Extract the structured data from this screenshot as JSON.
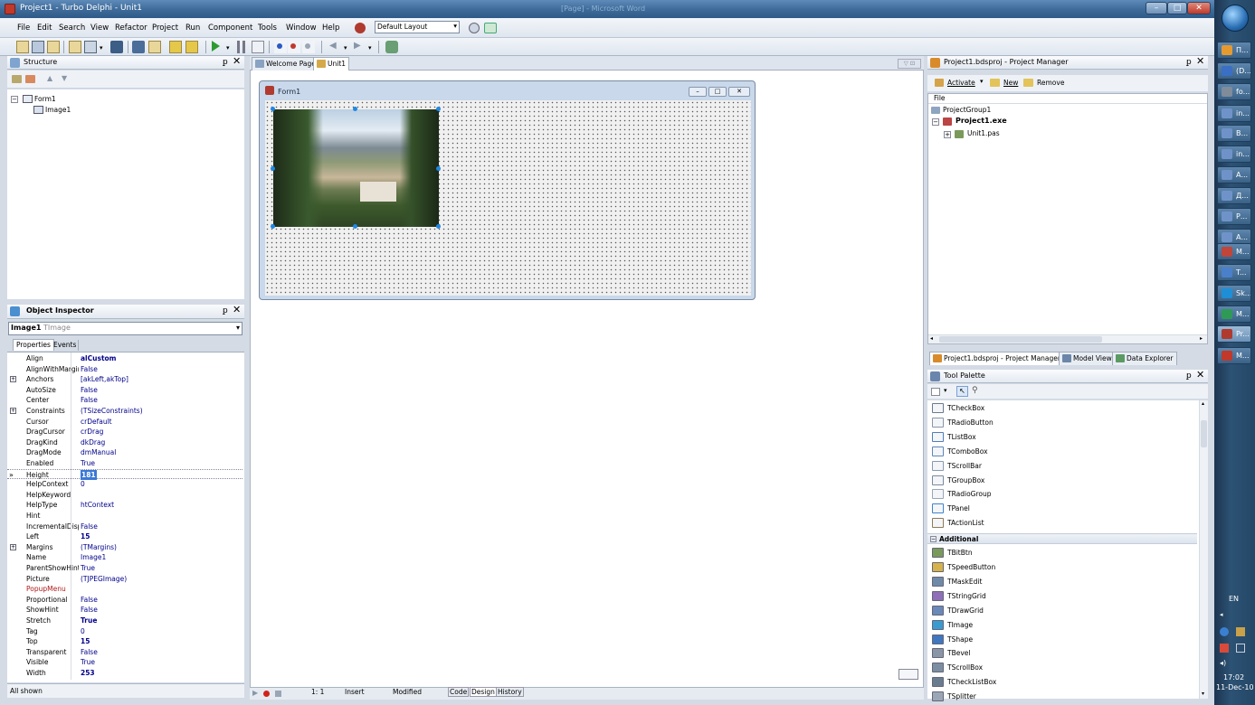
{
  "titlebar": {
    "title": "Project1 - Turbo Delphi - Unit1",
    "background_title": "[Page] - Microsoft Word"
  },
  "menubar": [
    "File",
    "Edit",
    "Search",
    "View",
    "Refactor",
    "Project",
    "Run",
    "Component",
    "Tools",
    "Window",
    "Help"
  ],
  "layout_combo": "Default Layout",
  "structure": {
    "title": "Structure",
    "tree": [
      "Form1",
      "Image1"
    ]
  },
  "inspector": {
    "title": "Object Inspector",
    "object_name": "Image1",
    "object_type": "TImage",
    "tabs": [
      "Properties",
      "Events"
    ],
    "props": [
      {
        "n": "Align",
        "v": "alCustom",
        "b": true
      },
      {
        "n": "AlignWithMargins",
        "v": "False"
      },
      {
        "n": "Anchors",
        "v": "[akLeft,akTop]",
        "e": true
      },
      {
        "n": "AutoSize",
        "v": "False"
      },
      {
        "n": "Center",
        "v": "False"
      },
      {
        "n": "Constraints",
        "v": "(TSizeConstraints)",
        "e": true
      },
      {
        "n": "Cursor",
        "v": "crDefault"
      },
      {
        "n": "DragCursor",
        "v": "crDrag"
      },
      {
        "n": "DragKind",
        "v": "dkDrag"
      },
      {
        "n": "DragMode",
        "v": "dmManual"
      },
      {
        "n": "Enabled",
        "v": "True"
      },
      {
        "n": "Height",
        "v": "181",
        "sel": true
      },
      {
        "n": "HelpContext",
        "v": "0"
      },
      {
        "n": "HelpKeyword",
        "v": ""
      },
      {
        "n": "HelpType",
        "v": "htContext"
      },
      {
        "n": "Hint",
        "v": ""
      },
      {
        "n": "IncrementalDispl",
        "v": "False"
      },
      {
        "n": "Left",
        "v": "15",
        "b": true
      },
      {
        "n": "Margins",
        "v": "(TMargins)",
        "e": true
      },
      {
        "n": "Name",
        "v": "Image1"
      },
      {
        "n": "ParentShowHint",
        "v": "True"
      },
      {
        "n": "Picture",
        "v": "(TJPEGImage)"
      },
      {
        "n": "PopupMenu",
        "v": "",
        "red": true
      },
      {
        "n": "Proportional",
        "v": "False"
      },
      {
        "n": "ShowHint",
        "v": "False"
      },
      {
        "n": "Stretch",
        "v": "True",
        "b": true
      },
      {
        "n": "Tag",
        "v": "0"
      },
      {
        "n": "Top",
        "v": "15",
        "b": true
      },
      {
        "n": "Transparent",
        "v": "False"
      },
      {
        "n": "Visible",
        "v": "True"
      },
      {
        "n": "Width",
        "v": "253",
        "b": true
      }
    ],
    "status": "All shown"
  },
  "editor": {
    "tabs": [
      "Welcome Page",
      "Unit1"
    ],
    "form_caption": "Form1",
    "status": {
      "position": "1:  1",
      "mode": "Insert",
      "modified": "Modified",
      "tabs": [
        "Code",
        "Design",
        "History"
      ]
    }
  },
  "project_manager": {
    "title": "Project1.bdsproj - Project Manager",
    "buttons": [
      "Activate",
      "New",
      "Remove"
    ],
    "column": "File",
    "tree": [
      "ProjectGroup1",
      "Project1.exe",
      "Unit1.pas"
    ],
    "bottom_tabs": [
      "Project1.bdsproj - Project Manager",
      "Model View",
      "Data Explorer"
    ]
  },
  "tool_palette": {
    "title": "Tool Palette",
    "items_top": [
      "TCheckBox",
      "TRadioButton",
      "TListBox",
      "TComboBox",
      "TScrollBar",
      "TGroupBox",
      "TRadioGroup",
      "TPanel",
      "TActionList"
    ],
    "category": "Additional",
    "items_additional": [
      "TBitBtn",
      "TSpeedButton",
      "TMaskEdit",
      "TStringGrid",
      "TDrawGrid",
      "TImage",
      "TShape",
      "TBevel",
      "TScrollBox",
      "TCheckListBox",
      "TSplitter"
    ]
  },
  "taskbar": {
    "buttons": [
      "П...",
      "(D...",
      "fo...",
      "in...",
      "В...",
      "in...",
      "А...",
      "Д...",
      "Р...",
      "А...",
      "M...",
      "T...",
      "Sk...",
      "M...",
      "Pr...",
      "M..."
    ],
    "language": "EN",
    "time": "17:02",
    "date": "11-Dec-10"
  }
}
